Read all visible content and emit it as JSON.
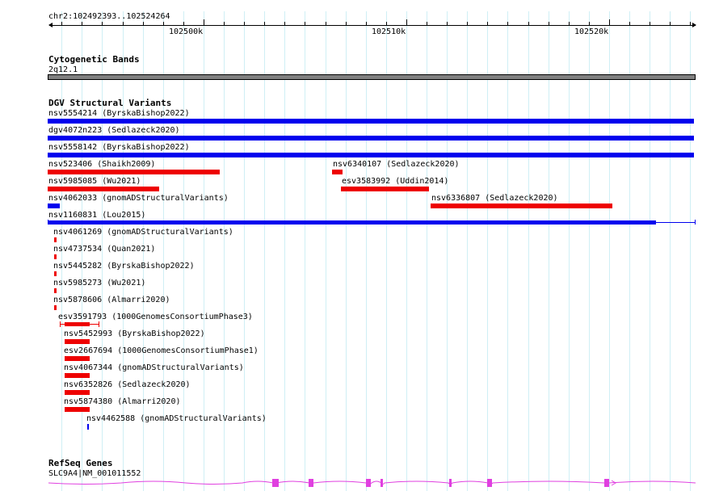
{
  "ruler": {
    "location": "chr2:102492393..102524264",
    "major_labels": [
      {
        "label": "102500k",
        "pos": 102500000
      },
      {
        "label": "102510k",
        "pos": 102510000
      },
      {
        "label": "102520k",
        "pos": 102520000
      }
    ]
  },
  "view": {
    "start": 102492393,
    "end": 102524264
  },
  "colors": {
    "gain": "#0000ee",
    "loss": "#ee0000",
    "gene": "#e040e0",
    "band": "#808080",
    "grid": "#cfeff5"
  },
  "cytoband": {
    "title": "Cytogenetic Bands",
    "band_label": "2q12.1"
  },
  "dgv": {
    "title": "DGV Structural Variants",
    "features": [
      {
        "label": "nsv5554214 (ByrskaBishop2022)",
        "type": "gain",
        "start": 102492393,
        "end": 102524264
      },
      {
        "label": "dgv4072n223 (Sedlazeck2020)",
        "type": "gain",
        "start": 102492393,
        "end": 102524264
      },
      {
        "label": "nsv5558142 (ByrskaBishop2022)",
        "type": "gain",
        "start": 102492393,
        "end": 102524264
      },
      {
        "label": "nsv523406 (Shaikh2009)",
        "type": "loss",
        "start": 102492393,
        "end": 102500890
      },
      {
        "label": "nsv6340107 (Sedlazeck2020)",
        "type": "loss",
        "start": 102506410,
        "end": 102506930
      },
      {
        "label": "nsv5985085 (Wu2021)",
        "type": "loss",
        "start": 102492393,
        "end": 102497890
      },
      {
        "label": "esv3583992 (Uddin2014)",
        "type": "loss",
        "start": 102506850,
        "end": 102511210
      },
      {
        "label": "nsv4062033 (gnomADStructuralVariants)",
        "type": "gain",
        "start": 102492393,
        "end": 102492990
      },
      {
        "label": "nsv6336807 (Sedlazeck2020)",
        "type": "loss",
        "start": 102511290,
        "end": 102520250
      },
      {
        "label": "nsv1160831 (Lou2015)",
        "type": "gain",
        "start": 102492393,
        "end": 102524264
      },
      {
        "label": "nsv4061269 (gnomADStructuralVariants)",
        "type": "loss",
        "start": 102492650,
        "end": 102492730
      },
      {
        "label": "nsv4737534 (Quan2021)",
        "type": "loss",
        "start": 102492650,
        "end": 102492730
      },
      {
        "label": "nsv5445282 (ByrskaBishop2022)",
        "type": "loss",
        "start": 102492650,
        "end": 102492730
      },
      {
        "label": "nsv5985273 (Wu2021)",
        "type": "loss",
        "start": 102492650,
        "end": 102492730
      },
      {
        "label": "nsv5878606 (Almarri2020)",
        "type": "loss",
        "start": 102492650,
        "end": 102492730
      },
      {
        "label": "esv3591793 (1000GenomesConsortiumPhase3)",
        "type": "loss",
        "start": 102492970,
        "end": 102494440
      },
      {
        "label": "nsv5452993 (ByrskaBishop2022)",
        "type": "loss",
        "start": 102493170,
        "end": 102494440
      },
      {
        "label": "esv2667694 (1000GenomesConsortiumPhase1)",
        "type": "loss",
        "start": 102493170,
        "end": 102494440
      },
      {
        "label": "nsv4067344 (gnomADStructuralVariants)",
        "type": "loss",
        "start": 102493170,
        "end": 102494440
      },
      {
        "label": "nsv6352826 (Sedlazeck2020)",
        "type": "loss",
        "start": 102493170,
        "end": 102494440
      },
      {
        "label": "nsv5874380 (Almarri2020)",
        "type": "loss",
        "start": 102493170,
        "end": 102494440
      },
      {
        "label": "nsv4462588 (gnomADStructuralVariants)",
        "type": "gain",
        "start": 102494290,
        "end": 102494370
      }
    ]
  },
  "refseq": {
    "title": "RefSeq Genes",
    "gene_label": "SLC9A4|NM_001011552"
  }
}
